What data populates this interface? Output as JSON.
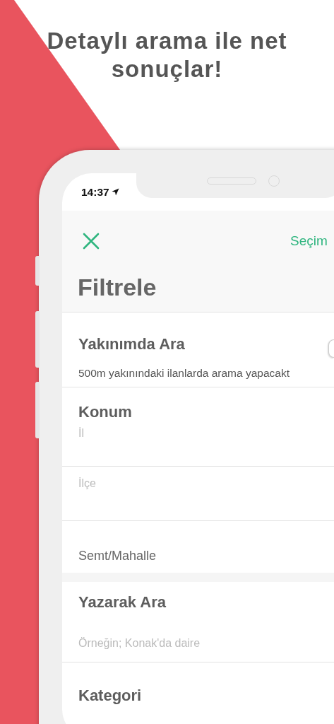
{
  "headline": "Detaylı arama ile net sonuçlar!",
  "status_bar": {
    "time": "14:37"
  },
  "nav": {
    "action": "Seçim"
  },
  "title": "Filtrele",
  "nearby": {
    "title": "Yakınımda Ara",
    "description": "500m yakınındaki ilanlarda arama yapacakt",
    "on": false
  },
  "location": {
    "title": "Konum",
    "fields": [
      {
        "placeholder": "İl"
      },
      {
        "placeholder": "İlçe"
      },
      {
        "value": "Semt/Mahalle"
      }
    ]
  },
  "text_search": {
    "title": "Yazarak Ara",
    "placeholder": "Örneğin; Konak'da daire"
  },
  "category": {
    "title": "Kategori"
  }
}
